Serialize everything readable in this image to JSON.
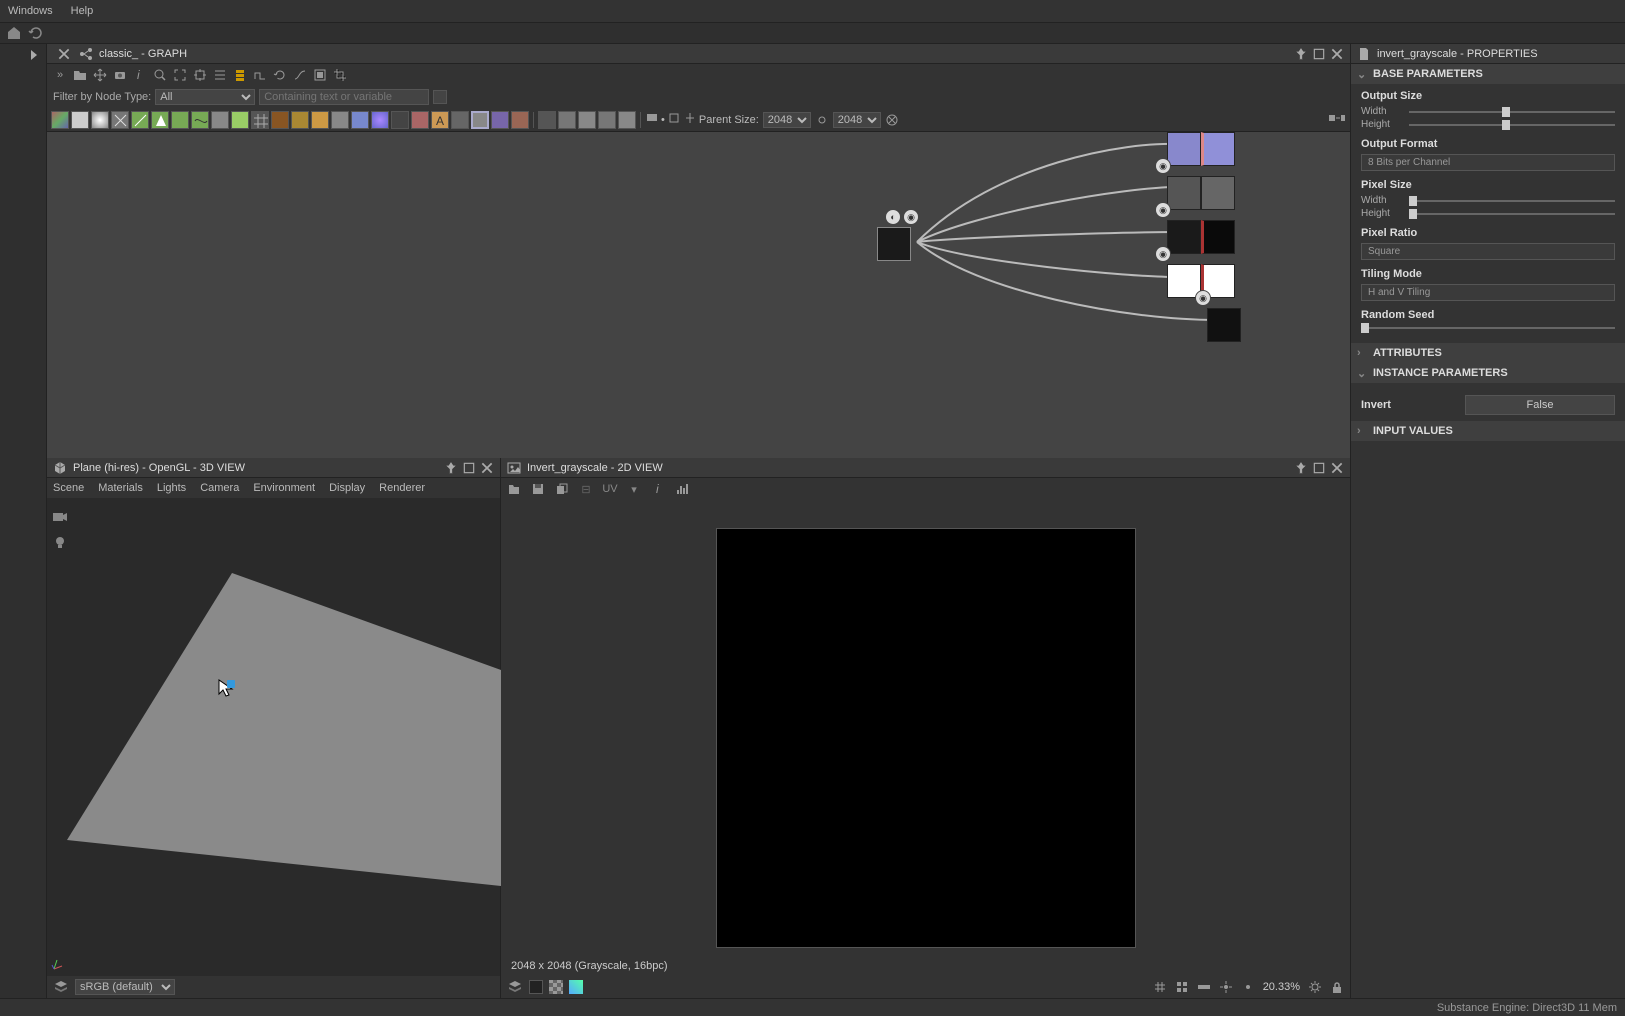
{
  "menubar": {
    "windows": "Windows",
    "help": "Help"
  },
  "graph_panel": {
    "title": "classic_ - GRAPH",
    "filter_label": "Filter by Node Type:",
    "filter_type_value": "All",
    "search_placeholder": "Containing text or variable",
    "parent_size_label": "Parent Size:",
    "parent_size_w": "2048",
    "parent_size_h": "2048"
  },
  "view3d_panel": {
    "title": "Plane (hi-res) - OpenGL - 3D VIEW",
    "menu": {
      "scene": "Scene",
      "materials": "Materials",
      "lights": "Lights",
      "camera": "Camera",
      "environment": "Environment",
      "display": "Display",
      "renderer": "Renderer"
    },
    "color_space": "sRGB (default)"
  },
  "view2d_panel": {
    "title": "Invert_grayscale - 2D VIEW",
    "info": "2048 x 2048 (Grayscale, 16bpc)",
    "uv_label": "UV",
    "zoom": "20.33%"
  },
  "props_panel": {
    "title": "invert_grayscale - PROPERTIES",
    "base_params": "BASE PARAMETERS",
    "output_size": "Output Size",
    "width_lbl": "Width",
    "height_lbl": "Height",
    "output_format": "Output Format",
    "output_format_value": "8 Bits per Channel",
    "pixel_size": "Pixel Size",
    "pixel_ratio": "Pixel Ratio",
    "pixel_ratio_value": "Square",
    "tiling_mode": "Tiling Mode",
    "tiling_mode_value": "H and V Tiling",
    "random_seed": "Random Seed",
    "attributes": "ATTRIBUTES",
    "instance_params": "INSTANCE PARAMETERS",
    "invert_label": "Invert",
    "invert_value": "False",
    "input_values": "INPUT VALUES"
  },
  "statusbar": {
    "engine": "Substance Engine: Direct3D 11  Mem"
  },
  "atomic_colors": [
    "#8d6b85",
    "#7a7a7a",
    "#c0b080",
    "#4a4a4a",
    "#8fae5c",
    "#b8985a",
    "#9c9c50",
    "#9cbc8c",
    "#8a8a8a",
    "#d0c8a0",
    "#7a7a7a",
    "#9c7c3c",
    "#b09c4c",
    "#b8a050",
    "#8c8c8c",
    "#6c8cc0",
    "#8888c0",
    "#3a3a3a",
    "#8c6565",
    "#c0a060",
    "#5c5c5c",
    "#8c8c8c",
    "#6c6cb0",
    "#8c6c5c",
    "#5c5c5c",
    "#7c7c7c",
    "#8c8c8c",
    "#7c7c7c",
    "#8c8c8c",
    "#9c9c9c"
  ]
}
